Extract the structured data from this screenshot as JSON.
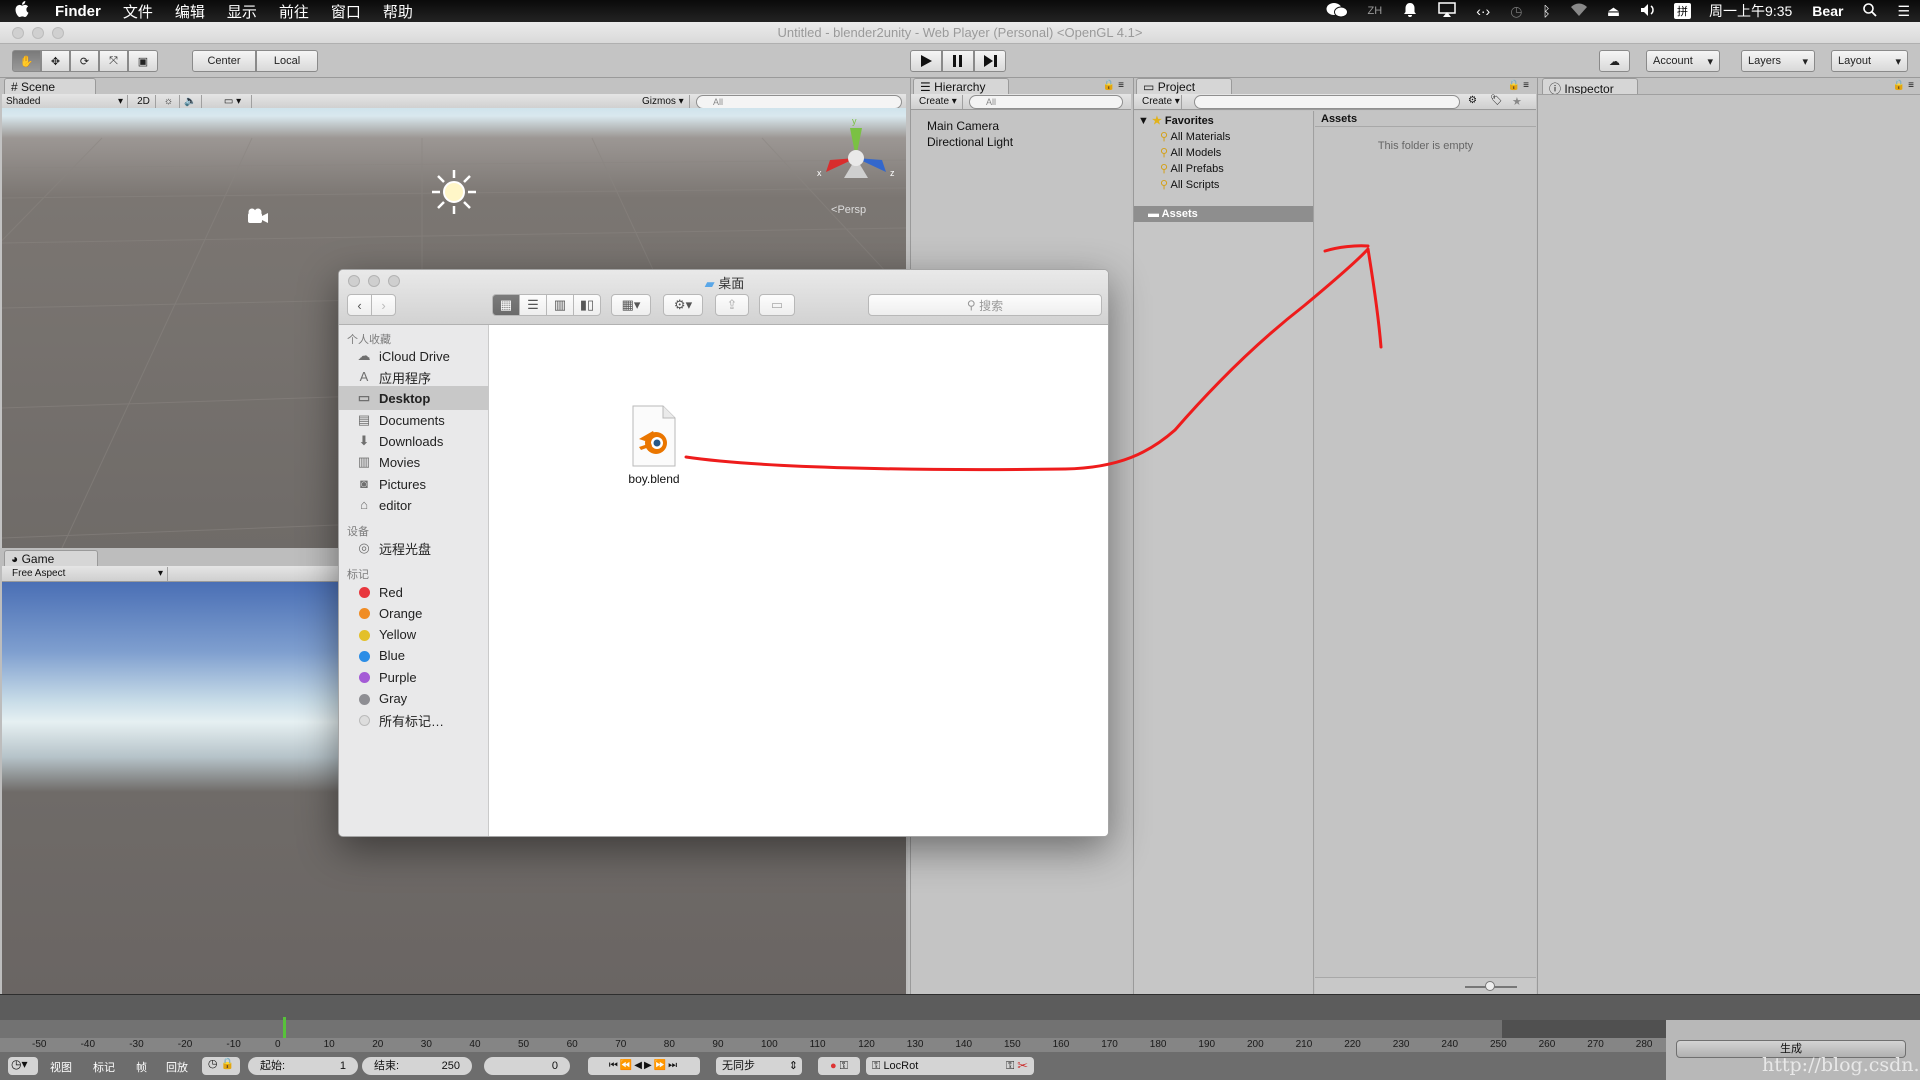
{
  "menubar": {
    "app": "Finder",
    "items": [
      "文件",
      "编辑",
      "显示",
      "前往",
      "窗口",
      "帮助"
    ],
    "clock": "周一上午9:35",
    "user": "Bear"
  },
  "unity": {
    "window_title": "Untitled - blender2unity - Web Player (Personal) <OpenGL 4.1>",
    "toolbar": {
      "pivot": "Center",
      "space": "Local",
      "account": "Account",
      "layers": "Layers",
      "layout": "Layout"
    },
    "scene": {
      "tab": "Scene",
      "shading": "Shaded",
      "mode_2d": "2D",
      "gizmos": "Gizmos",
      "search_placeholder": "All",
      "persp": "Persp",
      "axis_x": "x",
      "axis_y": "y",
      "axis_z": "z"
    },
    "game": {
      "tab": "Game",
      "aspect": "Free Aspect"
    },
    "hierarchy": {
      "tab": "Hierarchy",
      "create": "Create",
      "search_placeholder": "All",
      "items": [
        "Main Camera",
        "Directional Light"
      ]
    },
    "project": {
      "tab": "Project",
      "create": "Create",
      "favorites_label": "Favorites",
      "favorites": [
        "All Materials",
        "All Models",
        "All Prefabs",
        "All Scripts"
      ],
      "assets_folder": "Assets",
      "breadcrumb": "Assets",
      "empty_message": "This folder is empty"
    },
    "inspector": {
      "tab": "Inspector"
    }
  },
  "timeline": {
    "ticks": [
      "-50",
      "-40",
      "-30",
      "-20",
      "-10",
      "0",
      "10",
      "20",
      "30",
      "40",
      "50",
      "60",
      "70",
      "80",
      "90",
      "100",
      "110",
      "120",
      "130",
      "140",
      "150",
      "160",
      "170",
      "180",
      "190",
      "200",
      "210",
      "220",
      "230",
      "240",
      "250",
      "260",
      "270",
      "280"
    ],
    "menu": [
      "视图",
      "标记",
      "帧",
      "回放"
    ],
    "start_label": "起始:",
    "start_value": "1",
    "end_label": "结束:",
    "end_value": "250",
    "current_frame": "0",
    "sync": "无同步",
    "keying_set": "LocRot",
    "generate": "生成",
    "watermark": "http://blog.csdn.net/"
  },
  "finder": {
    "title": "桌面",
    "search_placeholder": "搜索",
    "sections": {
      "favorites": "个人收藏",
      "devices": "设备",
      "tags": "标记"
    },
    "favorites": [
      "iCloud Drive",
      "应用程序",
      "Desktop",
      "Documents",
      "Downloads",
      "Movies",
      "Pictures",
      "editor"
    ],
    "devices": [
      "远程光盘"
    ],
    "tags": [
      {
        "name": "Red",
        "color": "#e8373e"
      },
      {
        "name": "Orange",
        "color": "#f08c24"
      },
      {
        "name": "Yellow",
        "color": "#e3c02a"
      },
      {
        "name": "Blue",
        "color": "#2b8de6"
      },
      {
        "name": "Purple",
        "color": "#a45bd6"
      },
      {
        "name": "Gray",
        "color": "#8e8e93"
      }
    ],
    "all_tags": "所有标记…",
    "file_name": "boy.blend"
  },
  "colors": {
    "annotation": "#ee1c1c",
    "blender_orange": "#ea7600",
    "blender_blue": "#265787"
  }
}
